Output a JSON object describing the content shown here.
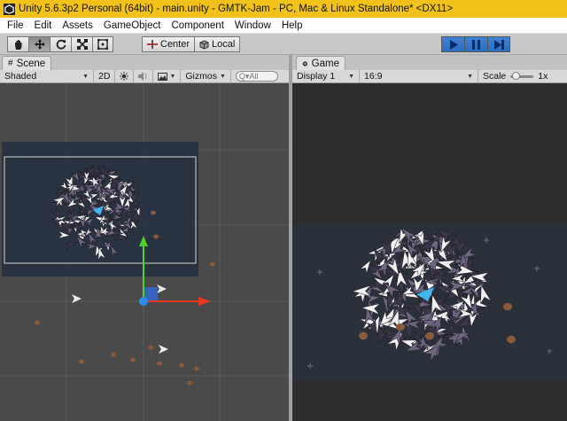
{
  "window": {
    "title": "Unity 5.6.3p2 Personal (64bit) - main.unity - GMTK-Jam - PC, Mac & Linux Standalone* <DX11>"
  },
  "menu": [
    "File",
    "Edit",
    "Assets",
    "GameObject",
    "Component",
    "Window",
    "Help"
  ],
  "toolbar": {
    "tools": [
      "hand-icon",
      "move-icon",
      "rotate-icon",
      "scale-icon",
      "rect-tool-icon"
    ],
    "pivot_label": "Center",
    "space_label": "Local",
    "play_controls": [
      "play-icon",
      "pause-icon",
      "step-icon"
    ]
  },
  "scene_panel": {
    "tab_label": "Scene",
    "shading_mode": "Shaded",
    "mode_2d_label": "2D",
    "gizmos_label": "Gizmos",
    "search_placeholder": "All"
  },
  "game_panel": {
    "tab_label": "Game",
    "display_label": "Display 1",
    "aspect_label": "16:9",
    "scale_label": "Scale",
    "scale_value": "1x"
  },
  "colors": {
    "title_bar": "#f2c21a",
    "play_active": "#3f83d6",
    "gizmo_x": "#e8381e",
    "gizmo_y": "#4fd22a",
    "gizmo_z": "#2d6ee8",
    "asteroid": "#8a5a3a"
  }
}
